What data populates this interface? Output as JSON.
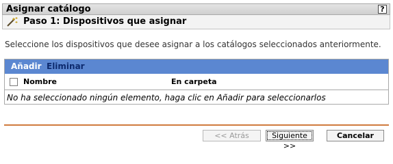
{
  "window": {
    "title": "Asignar catálogo",
    "help_label": "?"
  },
  "step": {
    "title": "Paso 1: Dispositivos que asignar",
    "icon": "wizard-wand-icon"
  },
  "instructions": "Seleccione los dispositivos que desee asignar a los catálogos seleccionados anteriormente.",
  "table": {
    "toolbar": {
      "add_label": "Añadir",
      "remove_label": "Eliminar"
    },
    "columns": [
      "Nombre",
      "En carpeta"
    ],
    "empty_message": "No ha seleccionado ningún elemento, haga clic en Añadir para seleccionarlos"
  },
  "buttons": {
    "back": "<< Atrás",
    "next": "Siguiente >>",
    "cancel": "Cancelar"
  },
  "colors": {
    "toolbar_bg": "#5b87d1",
    "divider": "#d07a3d"
  }
}
